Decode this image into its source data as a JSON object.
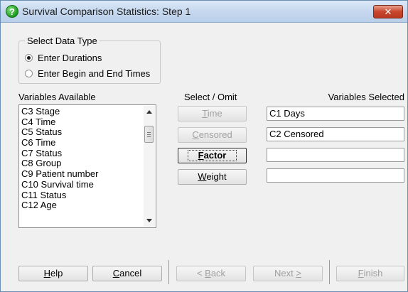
{
  "window": {
    "title": "Survival Comparison Statistics: Step 1",
    "close_label": "✕"
  },
  "data_type": {
    "legend": "Select Data Type",
    "options": [
      {
        "label": "Enter Durations",
        "checked": true
      },
      {
        "label": "Enter Begin and End Times",
        "checked": false
      }
    ]
  },
  "variables_available": {
    "label": "Variables Available",
    "items": [
      "C3 Stage",
      "C4 Time",
      "C5 Status",
      "C6 Time",
      "C7 Status",
      "C8 Group",
      "C9 Patient number",
      "C10 Survival time",
      "C11 Status",
      "C12 Age"
    ]
  },
  "select_omit": {
    "label": "Select / Omit",
    "buttons": [
      {
        "label": "Time",
        "accel": "T",
        "rest": "ime",
        "enabled": false
      },
      {
        "label": "Censored",
        "accel": "C",
        "rest": "ensored",
        "enabled": false
      },
      {
        "label": "Factor",
        "accel": "F",
        "rest": "actor",
        "enabled": true,
        "default": true
      },
      {
        "label": "Weight",
        "accel": "W",
        "rest": "eight",
        "enabled": true
      }
    ]
  },
  "variables_selected": {
    "label": "Variables Selected",
    "fields": [
      "C1 Days",
      "C2 Censored",
      "",
      ""
    ]
  },
  "footer": {
    "help": {
      "accel": "H",
      "rest": "elp"
    },
    "cancel": {
      "accel": "C",
      "rest": "ancel"
    },
    "back": {
      "prefix": "< ",
      "accel": "B",
      "rest": "ack"
    },
    "next": {
      "text": "Next ",
      "accel": ">"
    },
    "finish": {
      "accel": "F",
      "rest": "inish"
    }
  }
}
